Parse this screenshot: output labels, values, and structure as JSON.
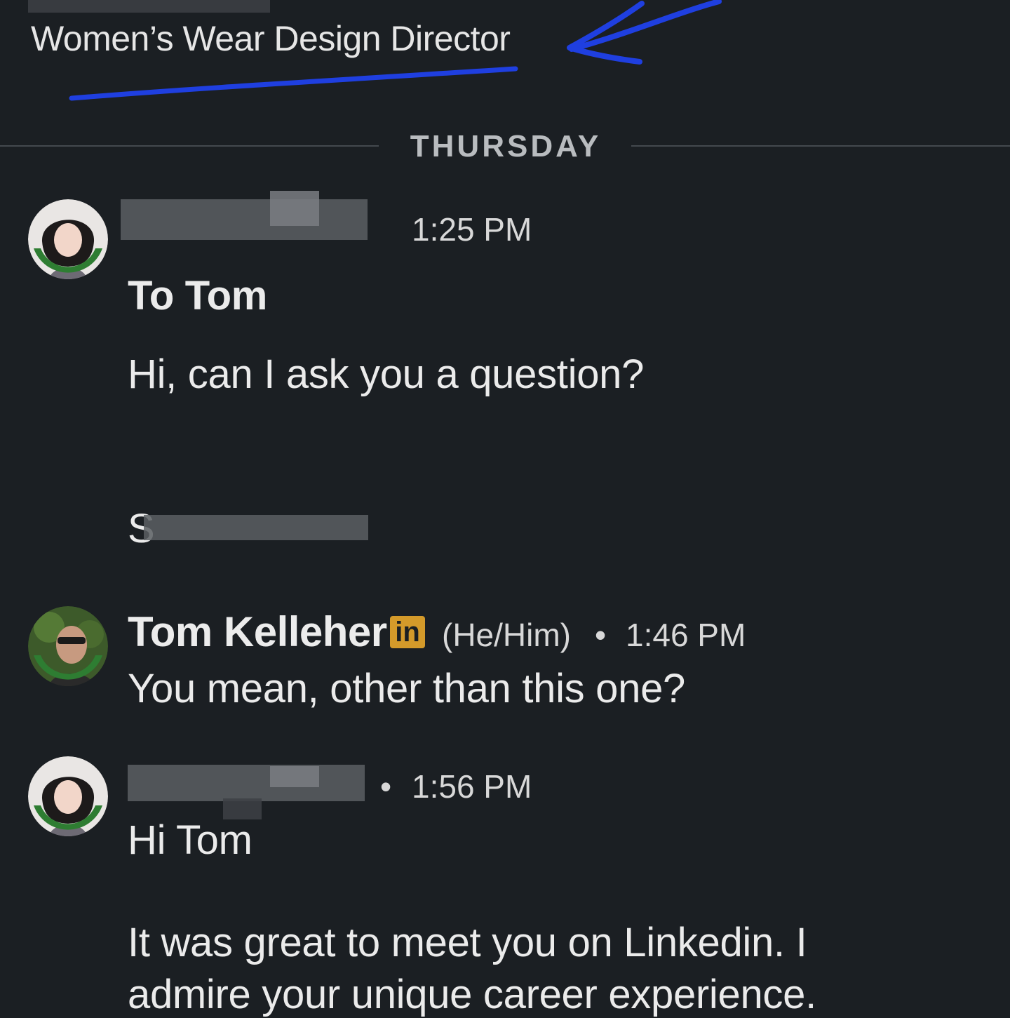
{
  "profile": {
    "headline": "Women’s Wear Design Director"
  },
  "thread": {
    "day_divider": "THURSDAY",
    "messages": [
      {
        "time": "1:25 PM",
        "lines": [
          "To Tom",
          "Hi, can I ask you a question?"
        ],
        "signature": "S"
      },
      {
        "sender": "Tom Kelleher",
        "badge": "in",
        "pronouns": "(He/Him)",
        "separator": "•",
        "time": "1:46 PM",
        "lines": [
          "You mean, other than this one?"
        ]
      },
      {
        "separator": "•",
        "time": "1:56 PM",
        "lines": [
          "Hi Tom",
          "It was great to meet you on Linkedin. I",
          "admire your unique career experience."
        ]
      }
    ]
  },
  "colors": {
    "background": "#1b1f23",
    "annotation_blue": "#1f3fe0",
    "open_to_work_green": "#2e7d32",
    "linkedin_badge": "#d49a2a"
  },
  "icons": {
    "badge": "linkedin-badge-icon",
    "avatar_frame": "open-to-work-ring"
  }
}
